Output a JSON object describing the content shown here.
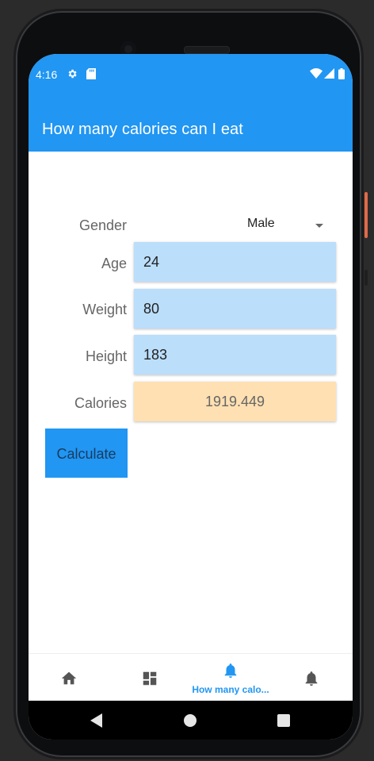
{
  "status_bar": {
    "time": "4:16"
  },
  "appbar": {
    "title": "How many calories can I eat"
  },
  "form": {
    "gender_label": "Gender",
    "gender_value": "Male",
    "age_label": "Age",
    "age_value": "24",
    "weight_label": "Weight",
    "weight_value": "80",
    "height_label": "Height",
    "height_value": "183",
    "calories_label": "Calories",
    "calories_value": "1919.449"
  },
  "calculate_button": {
    "label": "Calculate"
  },
  "bottom_nav": {
    "items": [
      {
        "icon": "home-icon"
      },
      {
        "icon": "dashboard-icon"
      },
      {
        "icon": "notifications-icon",
        "label": "How many calo...",
        "active": true
      },
      {
        "icon": "notifications-icon"
      }
    ]
  },
  "colors": {
    "primary": "#2196f3",
    "field_bg": "#bbdefb",
    "result_bg": "#ffe0b2"
  }
}
